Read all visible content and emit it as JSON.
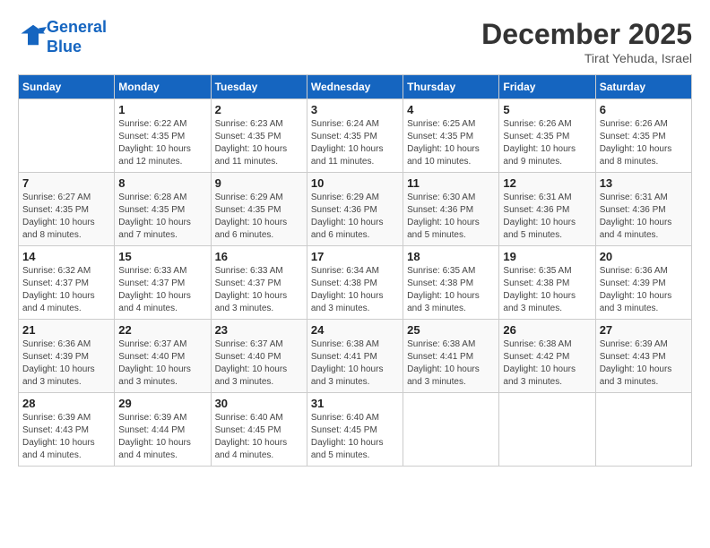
{
  "header": {
    "logo_line1": "General",
    "logo_line2": "Blue",
    "month_title": "December 2025",
    "subtitle": "Tirat Yehuda, Israel"
  },
  "weekdays": [
    "Sunday",
    "Monday",
    "Tuesday",
    "Wednesday",
    "Thursday",
    "Friday",
    "Saturday"
  ],
  "weeks": [
    [
      {
        "day": "",
        "info": ""
      },
      {
        "day": "1",
        "info": "Sunrise: 6:22 AM\nSunset: 4:35 PM\nDaylight: 10 hours\nand 12 minutes."
      },
      {
        "day": "2",
        "info": "Sunrise: 6:23 AM\nSunset: 4:35 PM\nDaylight: 10 hours\nand 11 minutes."
      },
      {
        "day": "3",
        "info": "Sunrise: 6:24 AM\nSunset: 4:35 PM\nDaylight: 10 hours\nand 11 minutes."
      },
      {
        "day": "4",
        "info": "Sunrise: 6:25 AM\nSunset: 4:35 PM\nDaylight: 10 hours\nand 10 minutes."
      },
      {
        "day": "5",
        "info": "Sunrise: 6:26 AM\nSunset: 4:35 PM\nDaylight: 10 hours\nand 9 minutes."
      },
      {
        "day": "6",
        "info": "Sunrise: 6:26 AM\nSunset: 4:35 PM\nDaylight: 10 hours\nand 8 minutes."
      }
    ],
    [
      {
        "day": "7",
        "info": "Sunrise: 6:27 AM\nSunset: 4:35 PM\nDaylight: 10 hours\nand 8 minutes."
      },
      {
        "day": "8",
        "info": "Sunrise: 6:28 AM\nSunset: 4:35 PM\nDaylight: 10 hours\nand 7 minutes."
      },
      {
        "day": "9",
        "info": "Sunrise: 6:29 AM\nSunset: 4:35 PM\nDaylight: 10 hours\nand 6 minutes."
      },
      {
        "day": "10",
        "info": "Sunrise: 6:29 AM\nSunset: 4:36 PM\nDaylight: 10 hours\nand 6 minutes."
      },
      {
        "day": "11",
        "info": "Sunrise: 6:30 AM\nSunset: 4:36 PM\nDaylight: 10 hours\nand 5 minutes."
      },
      {
        "day": "12",
        "info": "Sunrise: 6:31 AM\nSunset: 4:36 PM\nDaylight: 10 hours\nand 5 minutes."
      },
      {
        "day": "13",
        "info": "Sunrise: 6:31 AM\nSunset: 4:36 PM\nDaylight: 10 hours\nand 4 minutes."
      }
    ],
    [
      {
        "day": "14",
        "info": "Sunrise: 6:32 AM\nSunset: 4:37 PM\nDaylight: 10 hours\nand 4 minutes."
      },
      {
        "day": "15",
        "info": "Sunrise: 6:33 AM\nSunset: 4:37 PM\nDaylight: 10 hours\nand 4 minutes."
      },
      {
        "day": "16",
        "info": "Sunrise: 6:33 AM\nSunset: 4:37 PM\nDaylight: 10 hours\nand 3 minutes."
      },
      {
        "day": "17",
        "info": "Sunrise: 6:34 AM\nSunset: 4:38 PM\nDaylight: 10 hours\nand 3 minutes."
      },
      {
        "day": "18",
        "info": "Sunrise: 6:35 AM\nSunset: 4:38 PM\nDaylight: 10 hours\nand 3 minutes."
      },
      {
        "day": "19",
        "info": "Sunrise: 6:35 AM\nSunset: 4:38 PM\nDaylight: 10 hours\nand 3 minutes."
      },
      {
        "day": "20",
        "info": "Sunrise: 6:36 AM\nSunset: 4:39 PM\nDaylight: 10 hours\nand 3 minutes."
      }
    ],
    [
      {
        "day": "21",
        "info": "Sunrise: 6:36 AM\nSunset: 4:39 PM\nDaylight: 10 hours\nand 3 minutes."
      },
      {
        "day": "22",
        "info": "Sunrise: 6:37 AM\nSunset: 4:40 PM\nDaylight: 10 hours\nand 3 minutes."
      },
      {
        "day": "23",
        "info": "Sunrise: 6:37 AM\nSunset: 4:40 PM\nDaylight: 10 hours\nand 3 minutes."
      },
      {
        "day": "24",
        "info": "Sunrise: 6:38 AM\nSunset: 4:41 PM\nDaylight: 10 hours\nand 3 minutes."
      },
      {
        "day": "25",
        "info": "Sunrise: 6:38 AM\nSunset: 4:41 PM\nDaylight: 10 hours\nand 3 minutes."
      },
      {
        "day": "26",
        "info": "Sunrise: 6:38 AM\nSunset: 4:42 PM\nDaylight: 10 hours\nand 3 minutes."
      },
      {
        "day": "27",
        "info": "Sunrise: 6:39 AM\nSunset: 4:43 PM\nDaylight: 10 hours\nand 3 minutes."
      }
    ],
    [
      {
        "day": "28",
        "info": "Sunrise: 6:39 AM\nSunset: 4:43 PM\nDaylight: 10 hours\nand 4 minutes."
      },
      {
        "day": "29",
        "info": "Sunrise: 6:39 AM\nSunset: 4:44 PM\nDaylight: 10 hours\nand 4 minutes."
      },
      {
        "day": "30",
        "info": "Sunrise: 6:40 AM\nSunset: 4:45 PM\nDaylight: 10 hours\nand 4 minutes."
      },
      {
        "day": "31",
        "info": "Sunrise: 6:40 AM\nSunset: 4:45 PM\nDaylight: 10 hours\nand 5 minutes."
      },
      {
        "day": "",
        "info": ""
      },
      {
        "day": "",
        "info": ""
      },
      {
        "day": "",
        "info": ""
      }
    ]
  ]
}
